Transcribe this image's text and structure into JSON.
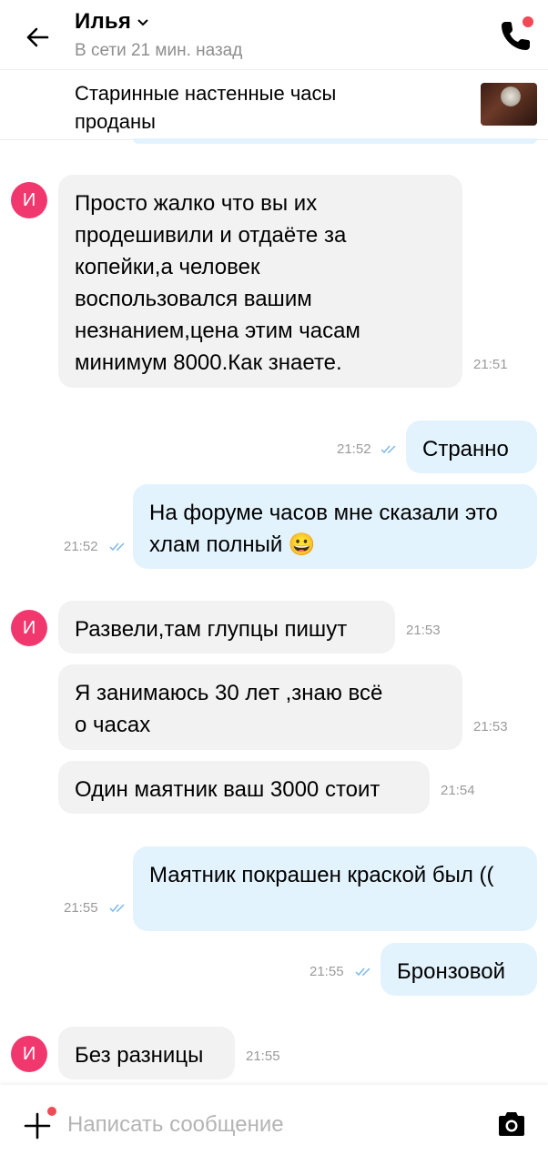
{
  "header": {
    "contact_name": "Илья",
    "status": "В сети 21 мин. назад"
  },
  "item": {
    "title": "Старинные настенные часы проданы"
  },
  "messages": [
    {
      "direction": "in",
      "avatar": "И",
      "text": "Просто жалко что вы их продешивили и отдаёте за копейки,а человек воспользовался вашим незнанием,цена этим часам минимум 8000.Как знаете.",
      "time": "21:51"
    },
    {
      "direction": "out",
      "text": "Странно",
      "time": "21:52",
      "read": true
    },
    {
      "direction": "out",
      "text": "На форуме часов мне сказали это хлам полный 😀",
      "time": "21:52",
      "read": true
    },
    {
      "direction": "in",
      "avatar": "И",
      "text": "Развели,там глупцы пишут",
      "time": "21:53"
    },
    {
      "direction": "in",
      "text": "Я занимаюсь 30 лет ,знаю всё о часах",
      "time": "21:53"
    },
    {
      "direction": "in",
      "text": "Один маятник ваш 3000 стоит",
      "time": "21:54"
    },
    {
      "direction": "out",
      "text": "Маятник покрашен краской был ((",
      "time": "21:55",
      "read": true
    },
    {
      "direction": "out",
      "text": "Бронзовой",
      "time": "21:55",
      "read": true
    },
    {
      "direction": "in",
      "avatar": "И",
      "text": "Без разницы",
      "time": "21:55"
    }
  ],
  "composer": {
    "placeholder": "Написать сообщение"
  },
  "colors": {
    "accent": "#f04a56",
    "avatar": "#f0386f",
    "incoming_bubble": "#f2f2f2",
    "outgoing_bubble": "#e2f3fd",
    "read_check": "#7fb8e6"
  },
  "icons": [
    "back-arrow-icon",
    "chevron-down-icon",
    "phone-icon",
    "plus-icon",
    "camera-icon",
    "double-check-icon"
  ]
}
